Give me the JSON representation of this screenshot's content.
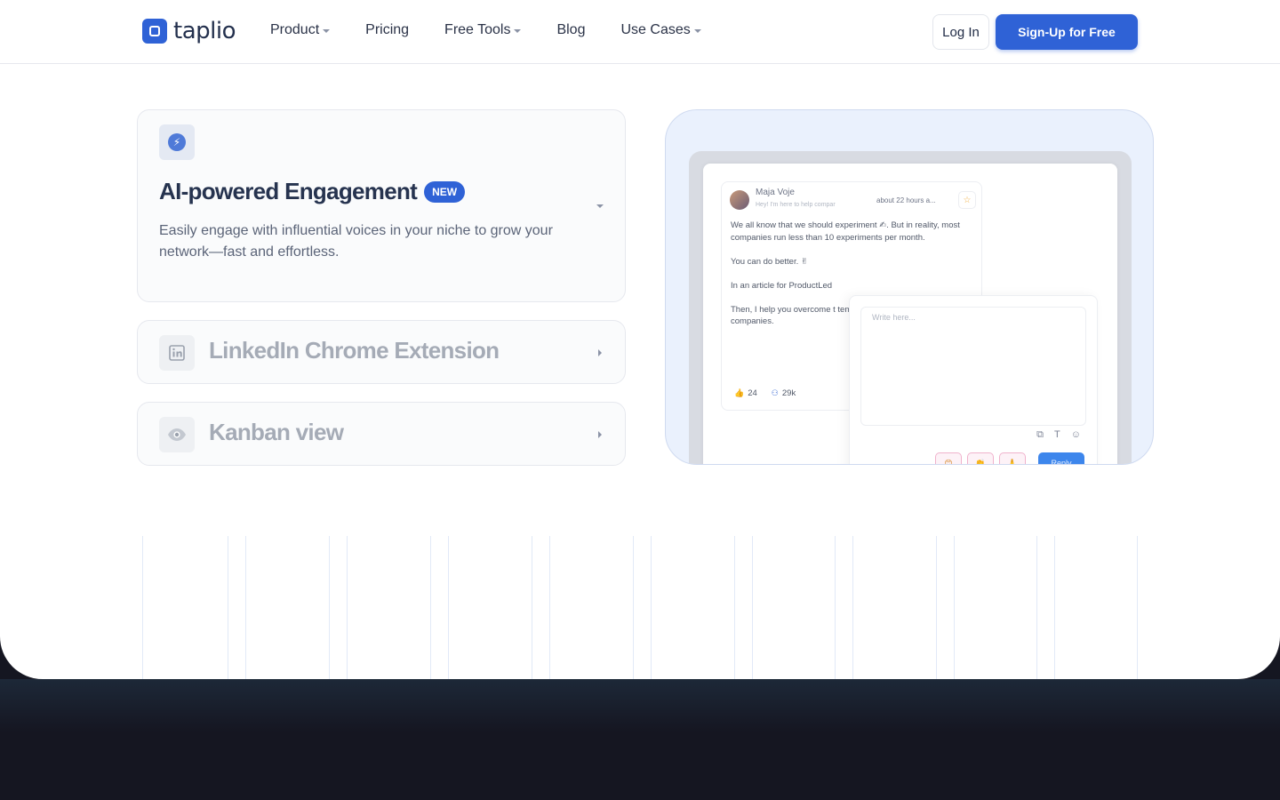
{
  "brand": {
    "name": "taplio"
  },
  "nav": {
    "items": [
      {
        "label": "Product",
        "has_dropdown": true
      },
      {
        "label": "Pricing",
        "has_dropdown": false
      },
      {
        "label": "Free Tools",
        "has_dropdown": true
      },
      {
        "label": "Blog",
        "has_dropdown": false
      },
      {
        "label": "Use Cases",
        "has_dropdown": true
      }
    ],
    "login_label": "Log In",
    "signup_label": "Sign-Up for Free"
  },
  "features": {
    "active": {
      "icon": "bolt-icon",
      "title": "AI-powered Engagement",
      "badge": "NEW",
      "description": "Easily engage with influential voices in your niche to grow your network—fast and effortless."
    },
    "collapsed": [
      {
        "icon": "linkedin-icon",
        "title": "LinkedIn Chrome Extension"
      },
      {
        "icon": "eye-icon",
        "title": "Kanban view"
      }
    ]
  },
  "preview": {
    "author": "Maja Voje",
    "author_sub": "Hey! I'm here to help compar",
    "time": "about 22 hours a...",
    "body": [
      "We all know that we should experiment ✍. But in reality, most companies run less than 10 experiments per month.",
      "You can do better. ✌",
      "In an article for ProductLed",
      "Then, I help you overcome t template for a growth ideat SaaS companies."
    ],
    "likes": "24",
    "followers": "29k",
    "reply_placeholder": "Write here...",
    "reply_label": "Reply",
    "emojis": [
      "😊",
      "👏",
      "🙏"
    ]
  },
  "colors": {
    "accent": "#2f62d6",
    "dark_bg": "#151621"
  }
}
